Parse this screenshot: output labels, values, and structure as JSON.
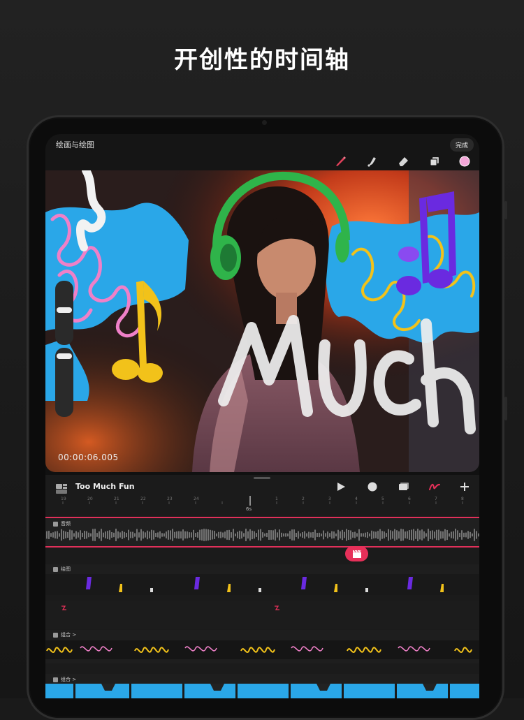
{
  "headline": "开创性的时间轴",
  "app": {
    "title": "绘画与绘图",
    "done_label": "完成",
    "tools": [
      {
        "name": "brush-icon",
        "color": "#e0405a"
      },
      {
        "name": "smudge-icon",
        "color": "#d8d8d8"
      },
      {
        "name": "eraser-icon",
        "color": "#d8d8d8"
      },
      {
        "name": "layers-icon",
        "color": "#d8d8d8"
      },
      {
        "name": "color-swatch-icon",
        "color": "#f3a6d8"
      }
    ]
  },
  "canvas": {
    "timecode": "00:00:06.005",
    "overlay_word": "MUCH"
  },
  "timeline": {
    "project_title": "Too Much Fun",
    "controls": [
      "play-icon",
      "record-icon",
      "clips-icon",
      "draw-icon",
      "add-icon"
    ],
    "ruler_labels": [
      "19",
      "20",
      "21",
      "22",
      "23",
      "24",
      "1",
      "2",
      "3",
      "4",
      "5",
      "6",
      "7",
      "8",
      "9"
    ],
    "playhead_label": "6s",
    "tracks": {
      "audio": "音频",
      "drawing": "绘图",
      "group1": "组合 >",
      "group2": "组合 >"
    }
  },
  "colors": {
    "accent": "#e63059",
    "blue": "#2aa7e8",
    "yellow": "#f2c21a",
    "purple": "#6a2ae0",
    "pink": "#ef80c8"
  }
}
